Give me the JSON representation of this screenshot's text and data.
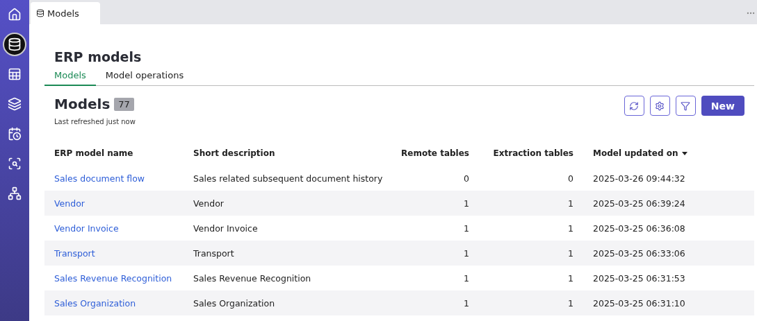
{
  "sidebar": {
    "items": [
      {
        "kind": "home",
        "selected": false
      },
      {
        "kind": "database",
        "selected": true
      },
      {
        "kind": "table",
        "selected": false
      },
      {
        "kind": "layers",
        "selected": false
      },
      {
        "kind": "schedule",
        "selected": false
      },
      {
        "kind": "search-table",
        "selected": false
      },
      {
        "kind": "network",
        "selected": false
      }
    ]
  },
  "document_tabs": [
    {
      "label": "Models",
      "selected": true
    }
  ],
  "page": {
    "title": "ERP models",
    "tabs": [
      {
        "label": "Models",
        "selected": true
      },
      {
        "label": "Model operations",
        "selected": false
      }
    ],
    "section": {
      "title": "Models",
      "count": "77",
      "subtitle": "Last refreshed just now"
    },
    "toolbar": {
      "buttons": [
        {
          "kind": "refresh"
        },
        {
          "kind": "settings"
        },
        {
          "kind": "filter"
        }
      ],
      "primary": "New"
    },
    "table": {
      "columns": [
        {
          "label": "ERP model name",
          "kind": "text",
          "sorted": false
        },
        {
          "label": "Short description",
          "kind": "text",
          "sorted": false
        },
        {
          "label": "Remote tables",
          "kind": "number",
          "sorted": false
        },
        {
          "label": "Extraction tables",
          "kind": "number",
          "sorted": false
        },
        {
          "label": "Model updated on",
          "kind": "text",
          "sorted": true
        }
      ],
      "rows": [
        [
          "Sales document flow",
          "Sales related subsequent document history",
          "0",
          "0",
          "2025-03-26 09:44:32"
        ],
        [
          "Vendor",
          "Vendor",
          "1",
          "1",
          "2025-03-25 06:39:24"
        ],
        [
          "Vendor Invoice",
          "Vendor Invoice",
          "1",
          "1",
          "2025-03-25 06:36:08"
        ],
        [
          "Transport",
          "Transport",
          "1",
          "1",
          "2025-03-25 06:33:06"
        ],
        [
          "Sales Revenue Recognition",
          "Sales Revenue Recognition",
          "1",
          "1",
          "2025-03-25 06:31:53"
        ],
        [
          "Sales Organization",
          "Sales Organization",
          "1",
          "1",
          "2025-03-25 06:31:10"
        ]
      ]
    }
  }
}
